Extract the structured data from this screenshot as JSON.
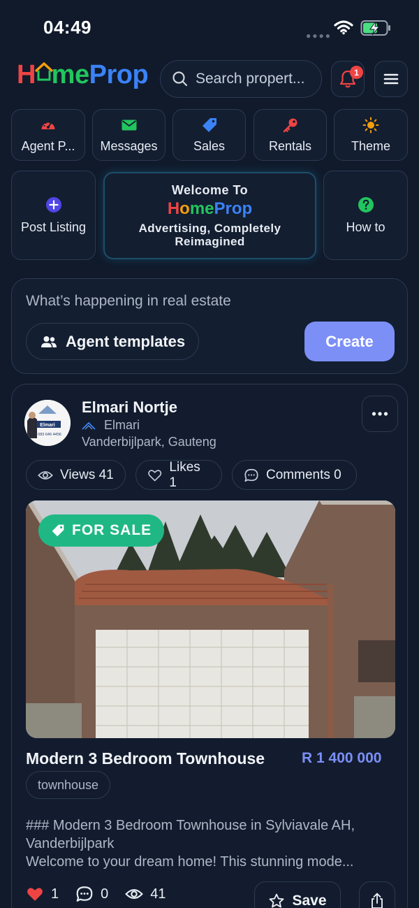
{
  "status_bar": {
    "time": "04:49"
  },
  "header": {
    "logo": {
      "h": "H",
      "o": "o",
      "rest1": "me",
      "rest2": "Prop"
    },
    "search_placeholder": "Search propert...",
    "notification_count": "1"
  },
  "quick_nav": [
    {
      "label": "Agent P...",
      "icon": "speedometer-icon",
      "color": "#ef4444"
    },
    {
      "label": "Messages",
      "icon": "envelope-icon",
      "color": "#22c55e"
    },
    {
      "label": "Sales",
      "icon": "tag-icon",
      "color": "#3b82f6"
    },
    {
      "label": "Rentals",
      "icon": "key-icon",
      "color": "#ef4444"
    },
    {
      "label": "Theme",
      "icon": "sun-icon",
      "color": "#f59e0b"
    }
  ],
  "tiles": {
    "post_listing": "Post Listing",
    "how_to": "How to",
    "welcome_title": "Welcome To",
    "welcome_tagline_1": "Advertising, Completely",
    "welcome_tagline_2": "Reimagined"
  },
  "composer": {
    "prompt": "What’s happening in real estate",
    "templates_label": "Agent templates",
    "create_label": "Create"
  },
  "post": {
    "author": "Elmari Nortje",
    "agency": "Elmari",
    "location": "Vanderbijlpark, Gauteng",
    "stats": {
      "views": "Views 41",
      "likes": "Likes 1",
      "comments": "Comments 0"
    },
    "badge": "FOR SALE",
    "title": "Modern 3 Bedroom Townhouse",
    "price": "R 1 400 000",
    "type": "townhouse",
    "description_1": "### Modern 3 Bedroom Townhouse in Sylviavale AH,",
    "description_2": "Vanderbijlpark",
    "description_3": "Welcome to your dream home! This stunning mode...",
    "actions": {
      "likes": "1",
      "comments": "0",
      "views": "41",
      "save": "Save"
    },
    "avatar_text": "Elmari",
    "avatar_phone": "083 646 4456"
  },
  "colors": {
    "background": "#101a2b",
    "accent": "#7c8ff7",
    "badge_green": "#1fb885",
    "like_red": "#ef4444"
  }
}
